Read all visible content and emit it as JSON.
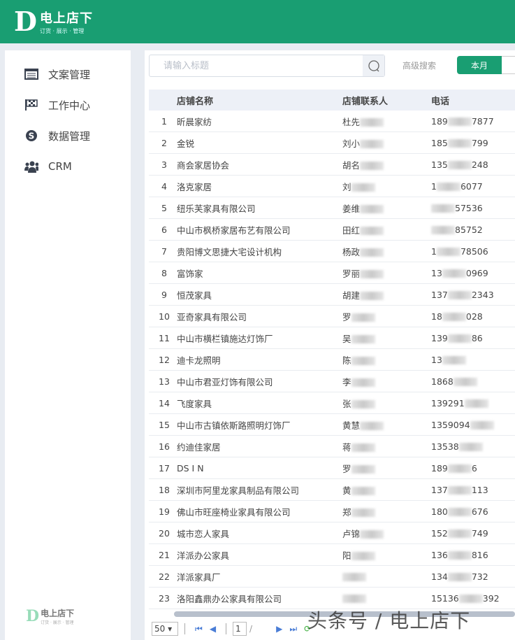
{
  "header": {
    "logo_letter": "D",
    "logo_title": "电上店下",
    "logo_sub": "订货 · 展示 · 管理"
  },
  "sidebar": {
    "items": [
      {
        "label": "文案管理"
      },
      {
        "label": "工作中心"
      },
      {
        "label": "数据管理"
      },
      {
        "label": "CRM"
      }
    ],
    "footer_logo_title": "电上店下",
    "footer_logo_sub": "订货 · 展示 · 管理"
  },
  "search": {
    "placeholder": "请输入标题",
    "advanced": "高级搜索",
    "period": "本月"
  },
  "table": {
    "headers": [
      "店铺名称",
      "店铺联系人",
      "电话"
    ],
    "rows": [
      {
        "i": "1",
        "name": "昕晨家纺",
        "contact": "杜先",
        "pre": "189",
        "post": "7877"
      },
      {
        "i": "2",
        "name": "金锐",
        "contact": "刘小",
        "pre": "185",
        "post": "799"
      },
      {
        "i": "3",
        "name": "商会家居协会",
        "contact": "胡名",
        "pre": "135",
        "post": "248"
      },
      {
        "i": "4",
        "name": "洛克家居",
        "contact": "刘",
        "pre": "1",
        "post": "6077"
      },
      {
        "i": "5",
        "name": "纽乐芙家具有限公司",
        "contact": "姜维",
        "pre": "",
        "post": "57536"
      },
      {
        "i": "6",
        "name": "中山市枫桥家居布艺有限公司",
        "contact": "田红",
        "pre": "",
        "post": "85752"
      },
      {
        "i": "7",
        "name": "贵阳博文思捷大宅设计机构",
        "contact": "杨政",
        "pre": "1",
        "post": "78506"
      },
      {
        "i": "8",
        "name": "富饰家",
        "contact": "罗丽",
        "pre": "13",
        "post": "0969"
      },
      {
        "i": "9",
        "name": "恒茂家具",
        "contact": "胡建",
        "pre": "137",
        "post": "2343"
      },
      {
        "i": "10",
        "name": "亚奇家具有限公司",
        "contact": "罗",
        "pre": "18",
        "post": "028"
      },
      {
        "i": "11",
        "name": "中山市横栏镇施达灯饰厂",
        "contact": "吴",
        "pre": "139",
        "post": "86"
      },
      {
        "i": "12",
        "name": "迪卡龙照明",
        "contact": "陈",
        "pre": "13",
        "post": ""
      },
      {
        "i": "13",
        "name": "中山市君亚灯饰有限公司",
        "contact": "李",
        "pre": "1868",
        "post": ""
      },
      {
        "i": "14",
        "name": "飞度家具",
        "contact": "张",
        "pre": "139291",
        "post": ""
      },
      {
        "i": "15",
        "name": "中山市古镇依斯路照明灯饰厂",
        "contact": "黄慧",
        "pre": "1359094",
        "post": ""
      },
      {
        "i": "16",
        "name": "约迪佳家居",
        "contact": "蒋",
        "pre": "13538",
        "post": ""
      },
      {
        "i": "17",
        "name": "DS I N",
        "contact": "罗",
        "pre": "189",
        "post": "6"
      },
      {
        "i": "18",
        "name": "深圳市阿里龙家具制品有限公司",
        "contact": "黄",
        "pre": "137",
        "post": "113"
      },
      {
        "i": "19",
        "name": "佛山市旺座椅业家具有限公司",
        "contact": "郑",
        "pre": "180",
        "post": "676"
      },
      {
        "i": "20",
        "name": "城市恋人家具",
        "contact": "卢锦",
        "pre": "152",
        "post": "749"
      },
      {
        "i": "21",
        "name": "洋派办公家具",
        "contact": "阳",
        "pre": "136",
        "post": "816"
      },
      {
        "i": "22",
        "name": "洋派家具厂",
        "contact": "",
        "pre": "134",
        "post": "732"
      },
      {
        "i": "23",
        "name": "洛阳鑫鼎办公家具有限公司",
        "contact": "",
        "pre": "15136",
        "post": "392"
      }
    ]
  },
  "pager": {
    "page_size": "50 ▾",
    "page": "1",
    "slash": "/"
  },
  "watermark": "头条号 / 电上店下"
}
